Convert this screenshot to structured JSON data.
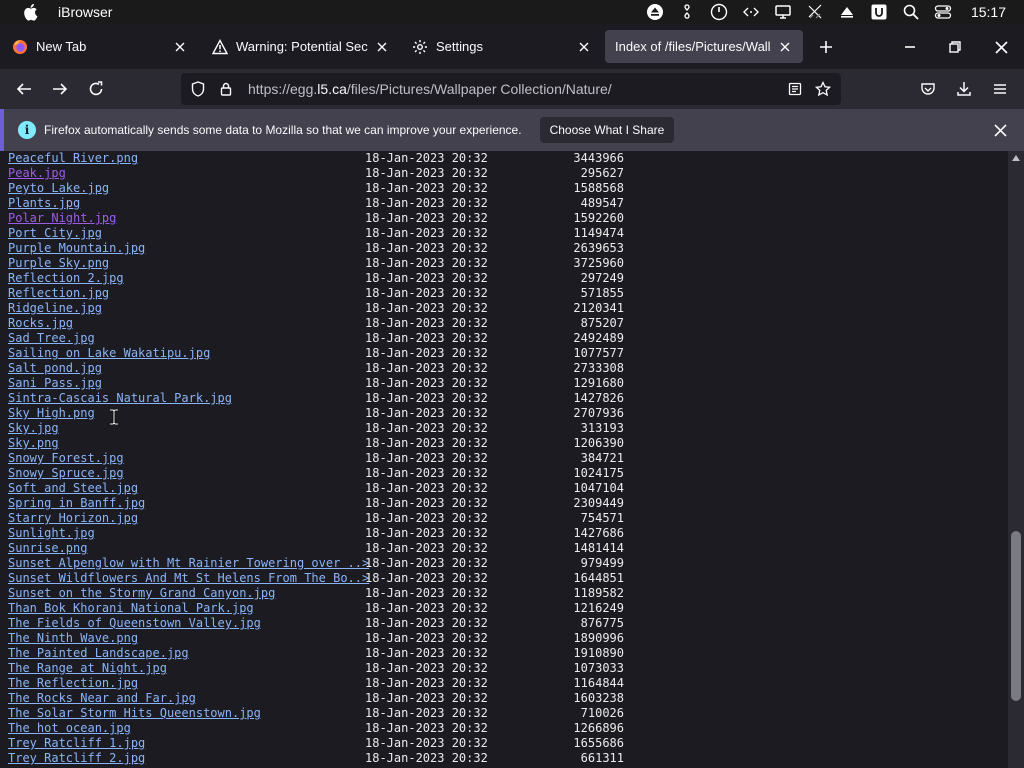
{
  "menubar": {
    "app_name": "iBrowser",
    "clock": "15:17",
    "status_icons": [
      "eject-icon",
      "scissors-icon",
      "power-icon",
      "code-icon",
      "monitor-icon",
      "mute-icon",
      "triangle-up-icon",
      "user-u-icon",
      "search-icon",
      "control-center-icon"
    ]
  },
  "tabs": [
    {
      "title": "New Tab",
      "icon": "firefox-icon",
      "active": false
    },
    {
      "title": "Warning: Potential Security Risk Ahead",
      "icon": "warning-icon",
      "active": false
    },
    {
      "title": "Settings",
      "icon": "gear-icon",
      "active": false
    },
    {
      "title": "Index of /files/Pictures/Wallpaper Collection/Nature/",
      "icon": "",
      "active": true
    }
  ],
  "urlbar": {
    "url_prefix": "https://egg.",
    "url_host": "l5.ca",
    "url_path": "/files/Pictures/Wallpaper Collection/Nature/"
  },
  "notification": {
    "message": "Firefox automatically sends some data to Mozilla so that we can improve your experience.",
    "button_label": "Choose What I Share"
  },
  "files": [
    {
      "name": "Peaceful River.png",
      "date": "18-Jan-2023 20:32",
      "size": "3443966",
      "visited": false
    },
    {
      "name": "Peak.jpg",
      "date": "18-Jan-2023 20:32",
      "size": "295627",
      "visited": true
    },
    {
      "name": "Peyto Lake.jpg",
      "date": "18-Jan-2023 20:32",
      "size": "1588568",
      "visited": false
    },
    {
      "name": "Plants.jpg",
      "date": "18-Jan-2023 20:32",
      "size": "489547",
      "visited": false
    },
    {
      "name": "Polar Night.jpg",
      "date": "18-Jan-2023 20:32",
      "size": "1592260",
      "visited": true
    },
    {
      "name": "Port City.jpg",
      "date": "18-Jan-2023 20:32",
      "size": "1149474",
      "visited": false
    },
    {
      "name": "Purple Mountain.jpg",
      "date": "18-Jan-2023 20:32",
      "size": "2639653",
      "visited": false
    },
    {
      "name": "Purple Sky.png",
      "date": "18-Jan-2023 20:32",
      "size": "3725960",
      "visited": false
    },
    {
      "name": "Reflection 2.jpg",
      "date": "18-Jan-2023 20:32",
      "size": "297249",
      "visited": false
    },
    {
      "name": "Reflection.jpg",
      "date": "18-Jan-2023 20:32",
      "size": "571855",
      "visited": false
    },
    {
      "name": "Ridgeline.jpg",
      "date": "18-Jan-2023 20:32",
      "size": "2120341",
      "visited": false
    },
    {
      "name": "Rocks.jpg",
      "date": "18-Jan-2023 20:32",
      "size": "875207",
      "visited": false
    },
    {
      "name": "Sad Tree.jpg",
      "date": "18-Jan-2023 20:32",
      "size": "2492489",
      "visited": false
    },
    {
      "name": "Sailing on Lake Wakatipu.jpg",
      "date": "18-Jan-2023 20:32",
      "size": "1077577",
      "visited": false
    },
    {
      "name": "Salt pond.jpg",
      "date": "18-Jan-2023 20:32",
      "size": "2733308",
      "visited": false
    },
    {
      "name": "Sani Pass.jpg",
      "date": "18-Jan-2023 20:32",
      "size": "1291680",
      "visited": false
    },
    {
      "name": "Sintra-Cascais Natural Park.jpg",
      "date": "18-Jan-2023 20:32",
      "size": "1427826",
      "visited": false
    },
    {
      "name": "Sky High.png",
      "date": "18-Jan-2023 20:32",
      "size": "2707936",
      "visited": false
    },
    {
      "name": "Sky.jpg",
      "date": "18-Jan-2023 20:32",
      "size": "313193",
      "visited": false
    },
    {
      "name": "Sky.png",
      "date": "18-Jan-2023 20:32",
      "size": "1206390",
      "visited": false
    },
    {
      "name": "Snowy Forest.jpg",
      "date": "18-Jan-2023 20:32",
      "size": "384721",
      "visited": false
    },
    {
      "name": "Snowy Spruce.jpg",
      "date": "18-Jan-2023 20:32",
      "size": "1024175",
      "visited": false
    },
    {
      "name": "Soft and Steel.jpg",
      "date": "18-Jan-2023 20:32",
      "size": "1047104",
      "visited": false
    },
    {
      "name": "Spring in Banff.jpg",
      "date": "18-Jan-2023 20:32",
      "size": "2309449",
      "visited": false
    },
    {
      "name": "Starry Horizon.jpg",
      "date": "18-Jan-2023 20:32",
      "size": "754571",
      "visited": false
    },
    {
      "name": "Sunlight.jpg",
      "date": "18-Jan-2023 20:32",
      "size": "1427686",
      "visited": false
    },
    {
      "name": "Sunrise.png",
      "date": "18-Jan-2023 20:32",
      "size": "1481414",
      "visited": false
    },
    {
      "name": "Sunset Alpenglow with Mt Rainier Towering over ..>",
      "date": "18-Jan-2023 20:32",
      "size": "979499",
      "visited": false
    },
    {
      "name": "Sunset Wildflowers And Mt St Helens From The Bo..>",
      "date": "18-Jan-2023 20:32",
      "size": "1644851",
      "visited": false
    },
    {
      "name": "Sunset on the Stormy Grand Canyon.jpg",
      "date": "18-Jan-2023 20:32",
      "size": "1189582",
      "visited": false
    },
    {
      "name": "Than Bok Khorani National Park.jpg",
      "date": "18-Jan-2023 20:32",
      "size": "1216249",
      "visited": false
    },
    {
      "name": "The Fields of Queenstown Valley.jpg",
      "date": "18-Jan-2023 20:32",
      "size": "876775",
      "visited": false
    },
    {
      "name": "The Ninth Wave.png",
      "date": "18-Jan-2023 20:32",
      "size": "1890996",
      "visited": false
    },
    {
      "name": "The Painted Landscape.jpg",
      "date": "18-Jan-2023 20:32",
      "size": "1910890",
      "visited": false
    },
    {
      "name": "The Range at Night.jpg",
      "date": "18-Jan-2023 20:32",
      "size": "1073033",
      "visited": false
    },
    {
      "name": "The Reflection.jpg",
      "date": "18-Jan-2023 20:32",
      "size": "1164844",
      "visited": false
    },
    {
      "name": "The Rocks Near and Far.jpg",
      "date": "18-Jan-2023 20:32",
      "size": "1603238",
      "visited": false
    },
    {
      "name": "The Solar Storm Hits Queenstown.jpg",
      "date": "18-Jan-2023 20:32",
      "size": "710026",
      "visited": false
    },
    {
      "name": "The hot ocean.jpg",
      "date": "18-Jan-2023 20:32",
      "size": "1266896",
      "visited": false
    },
    {
      "name": "Trey Ratcliff 1.jpg",
      "date": "18-Jan-2023 20:32",
      "size": "1655686",
      "visited": false
    },
    {
      "name": "Trey Ratcliff 2.jpg",
      "date": "18-Jan-2023 20:32",
      "size": "661311",
      "visited": false
    }
  ],
  "colors": {
    "link": "#8ab4f8",
    "visited_link": "#9b5de5",
    "background": "#1c1b22",
    "toolbar": "#2b2a33"
  }
}
